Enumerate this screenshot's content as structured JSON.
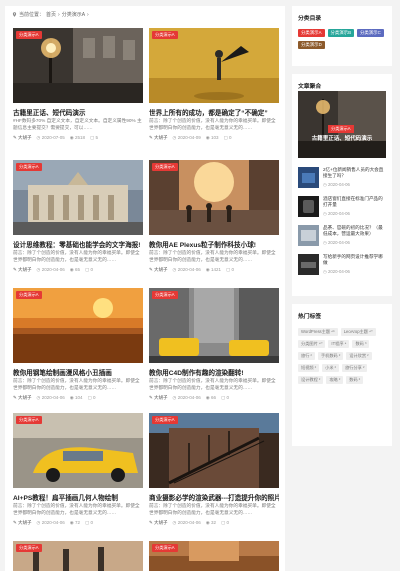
{
  "breadcrumb": {
    "label": "当前位置：",
    "home": "首页",
    "category": "分类演示A"
  },
  "posts": [
    {
      "tag": "分类演示A",
      "title": "古籍里正话、短代码演示",
      "desc": "#HF数码多70% 自定义文本，自定义文本。自定义属性90% 主题信息主要提交？需要提交，可以……",
      "author": "大胡子",
      "date": "2020-07-05",
      "views": "2518",
      "comments": "5"
    },
    {
      "tag": "分类演示A",
      "title": "世界上所有的成功，都是确定了“不确定”",
      "desc": "前言：除了个创造的价值，没有人能为你的幸福买单。即使全世界都明白你的创造能力，也是毫无意义无的……",
      "author": "大胡子",
      "date": "2020-04-09",
      "views": "103",
      "comments": "0"
    },
    {
      "tag": "分类演示A",
      "title": "设计思维教程：零基础也能学会的文字海报!",
      "desc": "前言：除了个创造的价值，没有人能为你的幸福买单。即使全世界都明白你的创造能力，也是毫无意义无的……",
      "author": "大胡子",
      "date": "2020-04-06",
      "views": "65",
      "comments": "0"
    },
    {
      "tag": "分类演示A",
      "title": "教你用AE Plexus粒子制作科技小球!",
      "desc": "前言：除了个创造的价值，没有人能为你的幸福买单。即使全世界都明白你的创造能力，也是毫无意义无的……",
      "author": "大胡子",
      "date": "2020-04-06",
      "views": "1421",
      "comments": "0"
    },
    {
      "tag": "分类演示A",
      "title": "教你用钢笔绘制画漫风格小丑插画",
      "desc": "前言：除了个创造的价值，没有人能为你的幸福买单。即使全世界都明白你的创造能力，也是毫无意义无的……",
      "author": "大胡子",
      "date": "2020-04-06",
      "views": "104",
      "comments": "0"
    },
    {
      "tag": "分类演示A",
      "title": "教你用C4D制作有趣的渲染翻转!",
      "desc": "前言：除了个创造的价值，没有人能为你的幸福买单。即使全世界都明白你的创造能力，也是毫无意义无的……",
      "author": "大胡子",
      "date": "2020-04-06",
      "views": "66",
      "comments": "0"
    },
    {
      "tag": "分类演示A",
      "title": "AI+PS教程！扁平插画几何人物绘制",
      "desc": "前言：除了个创造的价值，没有人能为你的幸福买单。即使全世界都明白你的创造能力，也是毫无意义无的……",
      "author": "大胡子",
      "date": "2020-04-06",
      "views": "72",
      "comments": "0"
    },
    {
      "tag": "分类演示A",
      "title": "商业摄影必学的渲染武器---打造提升你的照片质感",
      "desc": "前言：除了个创造的价值，没有人能为你的幸福买单。即使全世界都明白你的创造能力，也是毫无意义无的……",
      "author": "大胡子",
      "date": "2020-04-06",
      "views": "32",
      "comments": "0"
    },
    {
      "tag": "分类演示A",
      "title": "",
      "desc": "",
      "author": "",
      "date": "",
      "views": "",
      "comments": ""
    },
    {
      "tag": "分类演示A",
      "title": "",
      "desc": "",
      "author": "",
      "date": "",
      "views": "",
      "comments": ""
    }
  ],
  "sidebar": {
    "categories": {
      "title": "分类目录",
      "items": [
        {
          "label": "分类演示A",
          "color": "#e53935"
        },
        {
          "label": "分类演示B",
          "color": "#26a69a"
        },
        {
          "label": "分类演示C",
          "color": "#5c6bc0"
        },
        {
          "label": "分类演示D",
          "color": "#8d5a2b"
        }
      ]
    },
    "posts": {
      "title": "文章聚合",
      "feature": {
        "tag": "分类演示A",
        "title": "古籍里正话、短代码演示"
      },
      "items": [
        {
          "title": "2亿+位新闻销售人员的大会直接生了吗？",
          "date": "2020-04-06"
        },
        {
          "title": "酒店窗们直接在标准门产品的打开量",
          "date": "2020-04-06"
        },
        {
          "title": "品茶、官碗的初的比况？（最低成本，营运最大效果）",
          "date": "2020-04-06"
        },
        {
          "title": "写给新手的网页设计推荐学哪做",
          "date": "2020-04-06"
        }
      ]
    },
    "tags": {
      "title": "热门标签",
      "items": [
        "WordPress主题 ⁴⁶",
        "LeoArop主题 ⁴⁰",
        "分类图片 ⁴⁰",
        "IT程序 ⁴",
        "数码 ³",
        "旅行 ²",
        "手机数码 ²",
        "设计欣赏 ²",
        "短视频 ²",
        "小米 ²",
        "旅行分享 ²",
        "设计教程 ²",
        "攻略 ²",
        "数码 ²"
      ]
    }
  },
  "colors": {
    "accent": "#e53935"
  }
}
